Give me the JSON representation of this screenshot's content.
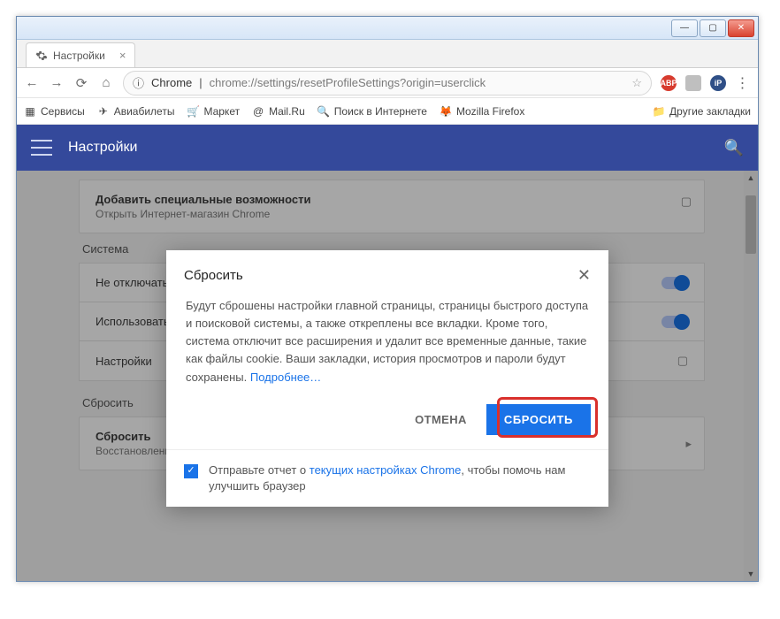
{
  "tab": {
    "title": "Настройки"
  },
  "omnibox": {
    "chrome_label": "Chrome",
    "url": "chrome://settings/resetProfileSettings?origin=userclick"
  },
  "bookmarks": {
    "services": "Сервисы",
    "items": [
      "Авиабилеты",
      "Маркет",
      "Mail.Ru",
      "Поиск в Интернете",
      "Mozilla Firefox"
    ],
    "other": "Другие закладки"
  },
  "header": {
    "title": "Настройки"
  },
  "cards": {
    "accessibility_title": "Добавить специальные возможности",
    "accessibility_sub": "Открыть Интернет-магазин Chrome"
  },
  "sections": {
    "system": "Система",
    "reset": "Сбросить"
  },
  "rows": {
    "row1": "Не отключать",
    "row2": "Использовать",
    "row3": "Настройки",
    "reset_title": "Сбросить",
    "reset_sub": "Восстановление настроек по умолчанию"
  },
  "dialog": {
    "title": "Сбросить",
    "body": "Будут сброшены настройки главной страницы, страницы быстрого доступа и поисковой системы, а также откреплены все вкладки. Кроме того, система отключит все расширения и удалит все временные данные, такие как файлы cookie. Ваши закладки, история просмотров и пароли будут сохранены.",
    "more": "Подробнее…",
    "cancel": "ОТМЕНА",
    "confirm": "СБРОСИТЬ",
    "report_a": "Отправьте отчет о ",
    "report_link": "текущих настройках Chrome",
    "report_b": ", чтобы помочь нам улучшить браузер"
  }
}
